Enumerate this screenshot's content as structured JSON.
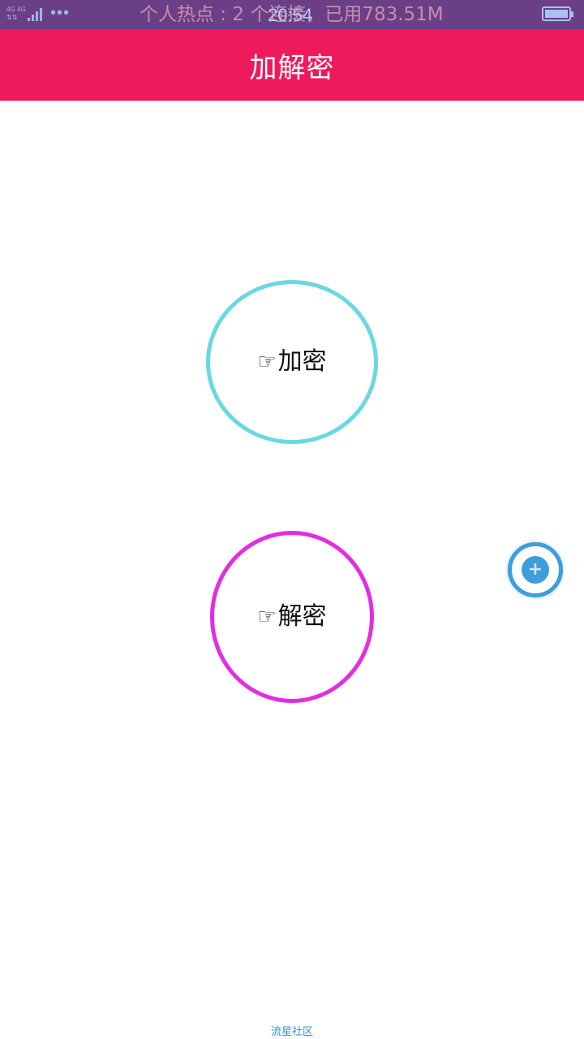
{
  "status_bar": {
    "network_label_1": "4G",
    "network_label_2": "4G",
    "more": "•••",
    "hotspot": "个人热点 : 2 个连接，已用783.51M",
    "time": "20:54",
    "battery_icon": "battery-full-icon",
    "signal_icon": "signal-icon"
  },
  "app_bar": {
    "title": "加解密"
  },
  "buttons": {
    "encrypt": {
      "icon": "☞",
      "label": "加密",
      "border_color": "#6ad8e2"
    },
    "decrypt": {
      "icon": "☞",
      "label": "解密",
      "border_color": "#e32de3"
    }
  },
  "fab": {
    "icon": "+",
    "color": "#3d9edb"
  },
  "footer": {
    "text": "流星社区"
  },
  "colors": {
    "status_bar": "#6a3f86",
    "app_bar": "#ef1a5c",
    "background": "#ffffff"
  }
}
